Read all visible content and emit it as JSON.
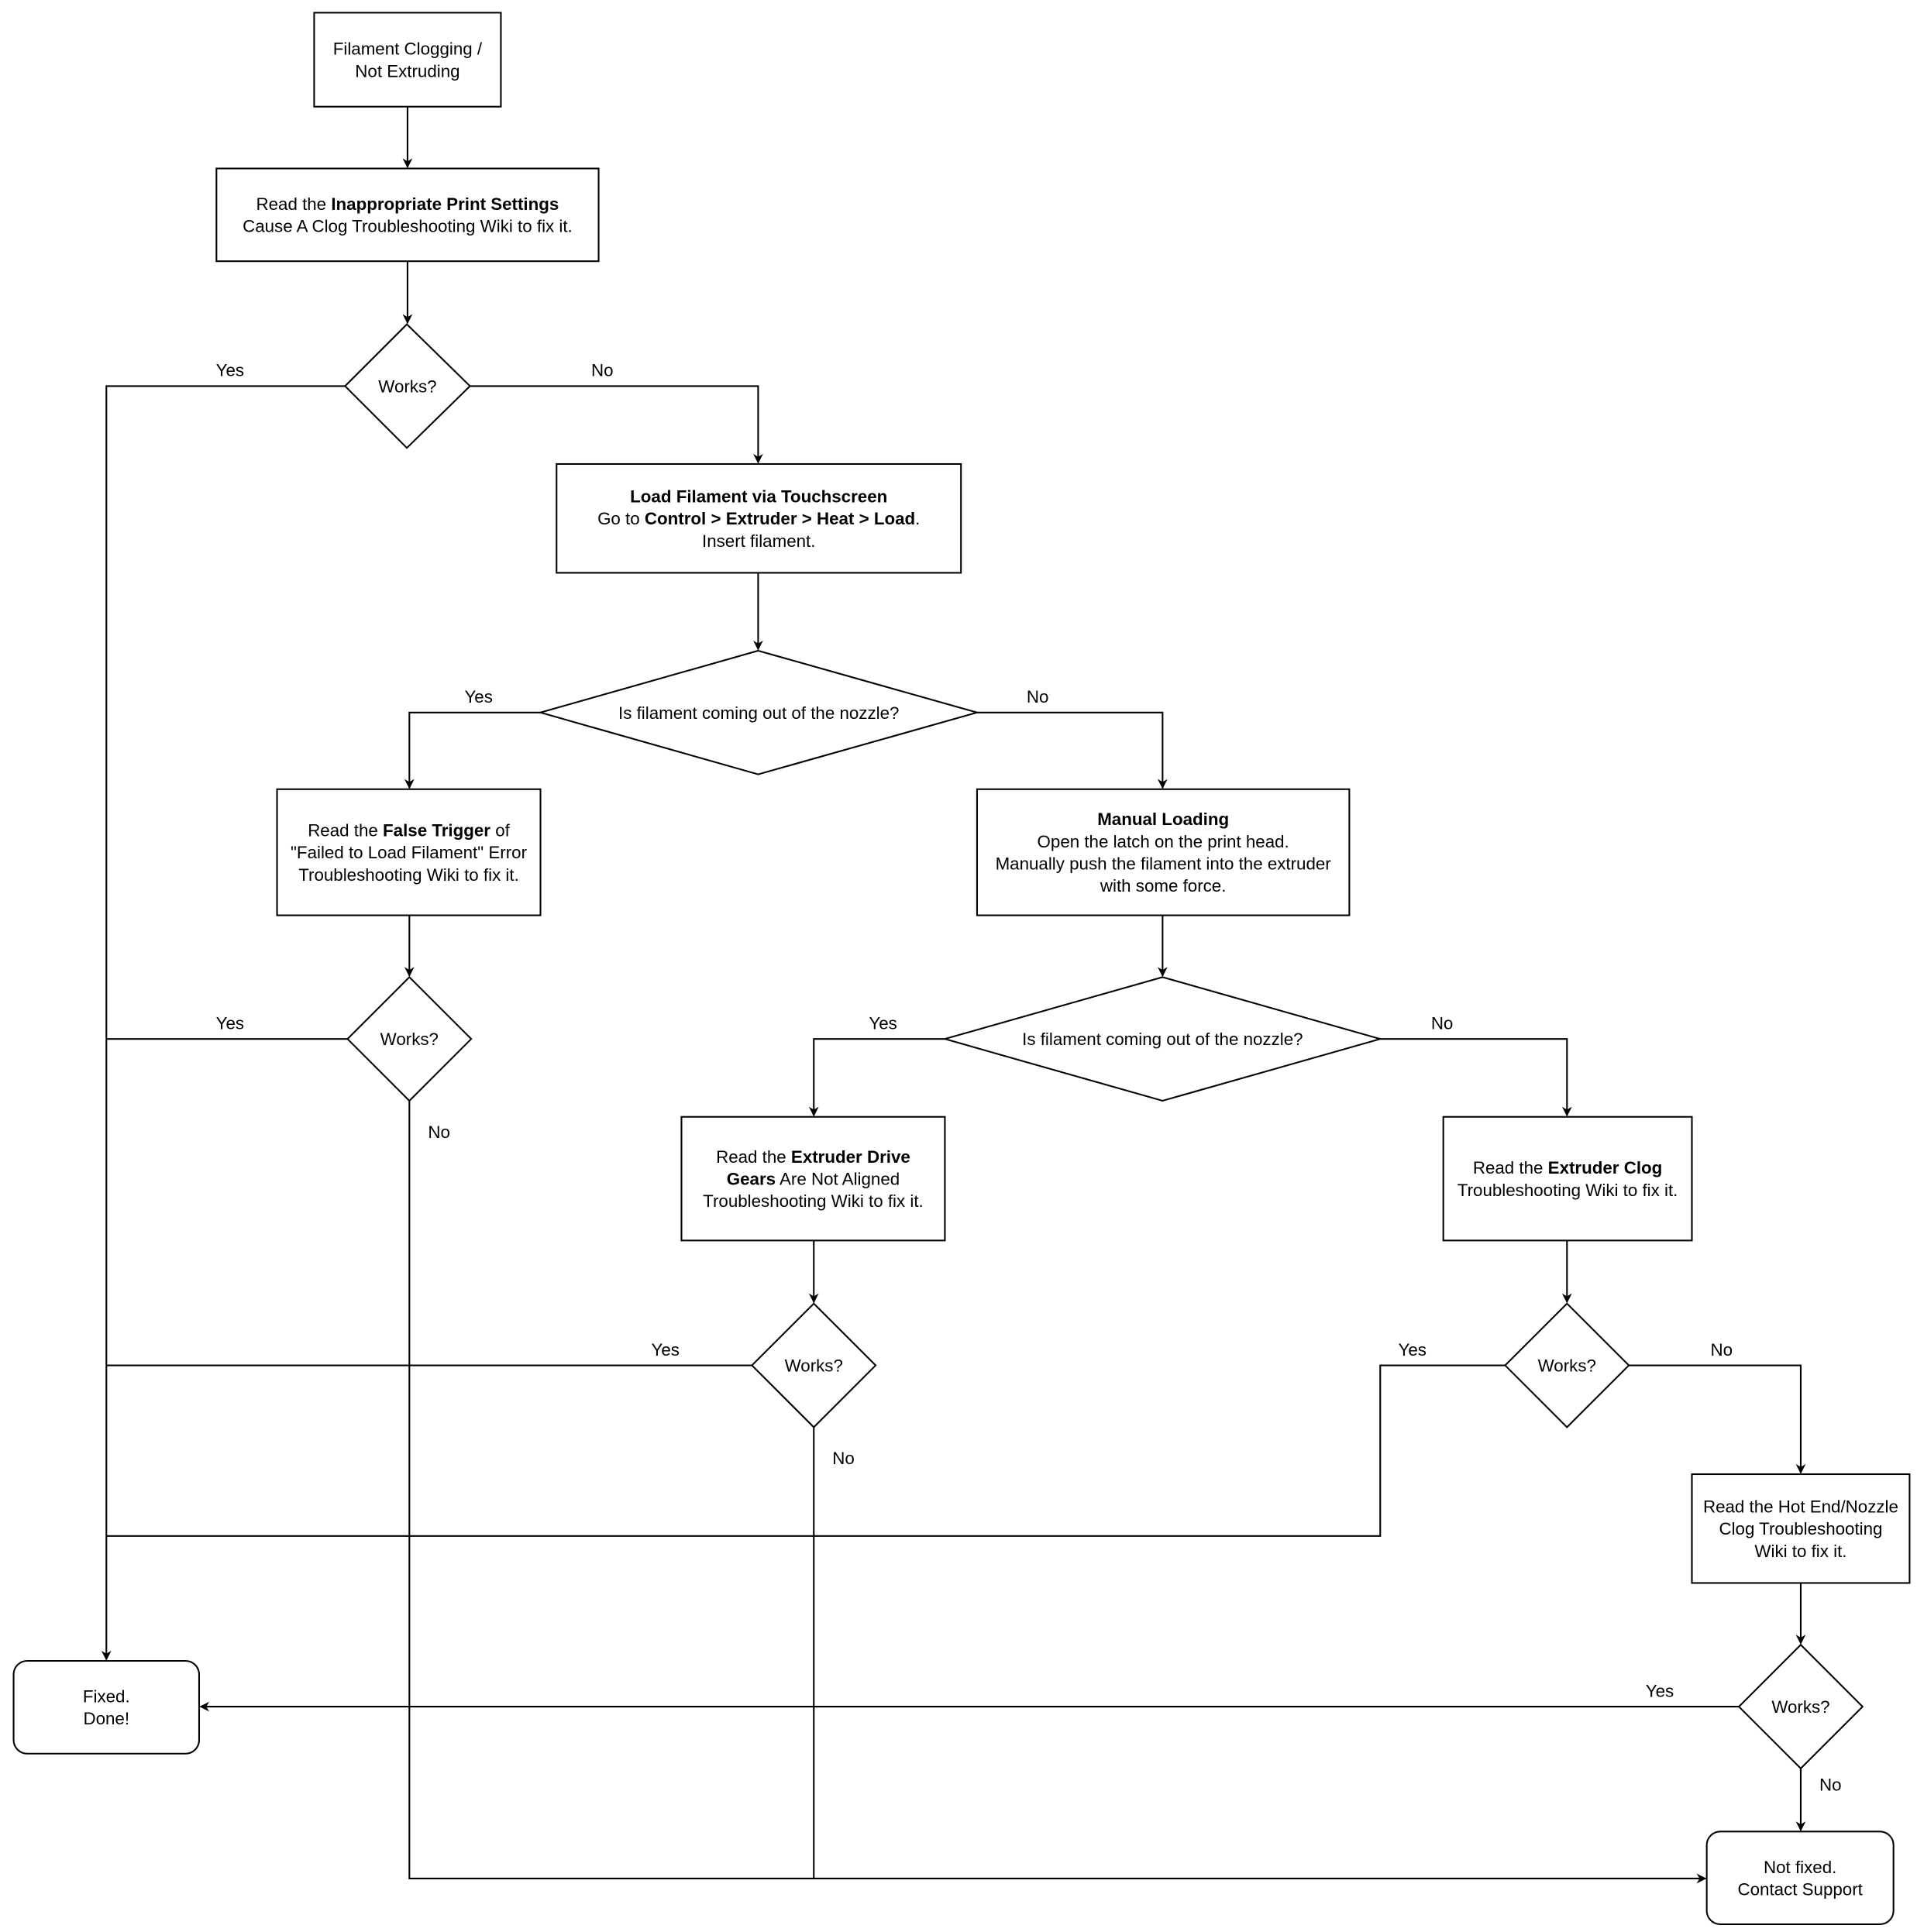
{
  "diagram": {
    "title": "Filament Clogging / Not Extruding",
    "colors": {
      "stroke": "#000000",
      "fill": "#ffffff",
      "text": "#000000"
    },
    "nodes": {
      "start": {
        "lines": [
          [
            {
              "t": "Filament Clogging /"
            }
          ],
          [
            {
              "t": "Not Extruding"
            }
          ]
        ]
      },
      "print_settings": {
        "lines": [
          [
            {
              "t": "Read the "
            },
            {
              "t": "Inappropriate Print Settings",
              "b": true
            }
          ],
          [
            {
              "t": "Cause A Clog Troubleshooting Wiki to fix it."
            }
          ]
        ]
      },
      "works1": {
        "lines": [
          [
            {
              "t": "Works?"
            }
          ]
        ]
      },
      "load_touchscreen": {
        "lines": [
          [
            {
              "t": "Load Filament via Touchscreen",
              "b": true
            }
          ],
          [
            {
              "t": "Go to "
            },
            {
              "t": "Control > Extruder > Heat > Load",
              "b": true
            },
            {
              "t": "."
            }
          ],
          [
            {
              "t": "Insert filament."
            }
          ]
        ]
      },
      "nozzle_q1": {
        "lines": [
          [
            {
              "t": "Is filament coming out of the nozzle?"
            }
          ]
        ]
      },
      "false_trigger": {
        "lines": [
          [
            {
              "t": "Read the "
            },
            {
              "t": "False Trigger",
              "b": true
            },
            {
              "t": " of"
            }
          ],
          [
            {
              "t": "\"Failed to Load Filament\" Error"
            }
          ],
          [
            {
              "t": "Troubleshooting Wiki to fix it."
            }
          ]
        ]
      },
      "manual_loading": {
        "lines": [
          [
            {
              "t": "Manual Loading",
              "b": true
            }
          ],
          [
            {
              "t": "Open the latch on the print head."
            }
          ],
          [
            {
              "t": "Manually push the filament into the extruder"
            }
          ],
          [
            {
              "t": "with some force."
            }
          ]
        ]
      },
      "works2": {
        "lines": [
          [
            {
              "t": "Works?"
            }
          ]
        ]
      },
      "nozzle_q2": {
        "lines": [
          [
            {
              "t": "Is filament coming out of the nozzle?"
            }
          ]
        ]
      },
      "drive_gears": {
        "lines": [
          [
            {
              "t": "Read the "
            },
            {
              "t": "Extruder Drive",
              "b": true
            }
          ],
          [
            {
              "t": "Gears",
              "b": true
            },
            {
              "t": " Are Not Aligned"
            }
          ],
          [
            {
              "t": "Troubleshooting Wiki to fix it."
            }
          ]
        ]
      },
      "extruder_clog": {
        "lines": [
          [
            {
              "t": "Read the "
            },
            {
              "t": "Extruder Clog",
              "b": true
            }
          ],
          [
            {
              "t": "Troubleshooting Wiki to fix it."
            }
          ]
        ]
      },
      "works3": {
        "lines": [
          [
            {
              "t": "Works?"
            }
          ]
        ]
      },
      "works4": {
        "lines": [
          [
            {
              "t": "Works?"
            }
          ]
        ]
      },
      "hot_end": {
        "lines": [
          [
            {
              "t": "Read the Hot End/Nozzle"
            }
          ],
          [
            {
              "t": "Clog Troubleshooting"
            }
          ],
          [
            {
              "t": "Wiki to fix it."
            }
          ]
        ]
      },
      "works5": {
        "lines": [
          [
            {
              "t": "Works?"
            }
          ]
        ]
      },
      "fixed": {
        "lines": [
          [
            {
              "t": "Fixed."
            }
          ],
          [
            {
              "t": "Done!"
            }
          ]
        ]
      },
      "not_fixed": {
        "lines": [
          [
            {
              "t": "Not fixed."
            }
          ],
          [
            {
              "t": "Contact Support"
            }
          ]
        ]
      }
    },
    "edge_labels": {
      "works1_yes": "Yes",
      "works1_no": "No",
      "nozzle_q1_yes": "Yes",
      "nozzle_q1_no": "No",
      "works2_yes": "Yes",
      "works2_no": "No",
      "nozzle_q2_yes": "Yes",
      "nozzle_q2_no": "No",
      "works3_yes": "Yes",
      "works3_no": "No",
      "works4_yes": "Yes",
      "works4_no": "No",
      "works5_yes": "Yes",
      "works5_no": "No"
    }
  }
}
